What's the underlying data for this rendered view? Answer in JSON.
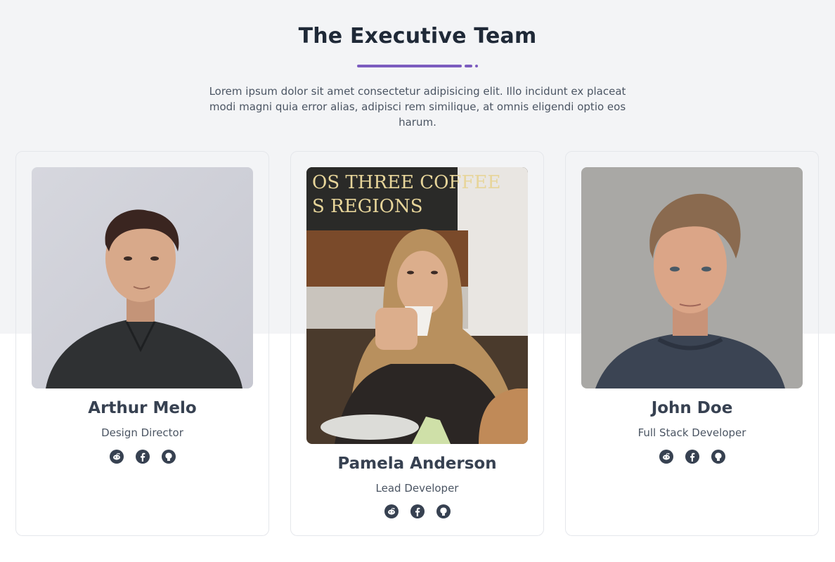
{
  "section": {
    "title": "The Executive Team",
    "intro": "Lorem ipsum dolor sit amet consectetur adipisicing elit. Illo incidunt ex placeat modi magni quia error alias, adipisci rem similique, at omnis eligendi optio eos harum."
  },
  "colors": {
    "accent": "#7c5cbf",
    "heading": "#1f2937",
    "text": "#4b5563",
    "icon": "#374151"
  },
  "members": [
    {
      "name": "Arthur Melo",
      "role": "Design Director",
      "socials": [
        "reddit-icon",
        "facebook-icon",
        "github-icon"
      ]
    },
    {
      "name": "Pamela Anderson",
      "role": "Lead Developer",
      "photo_sign": "OS THREE COFFEE S REGIONS",
      "socials": [
        "reddit-icon",
        "facebook-icon",
        "github-icon"
      ]
    },
    {
      "name": "John Doe",
      "role": "Full Stack Developer",
      "socials": [
        "reddit-icon",
        "facebook-icon",
        "github-icon"
      ]
    }
  ]
}
